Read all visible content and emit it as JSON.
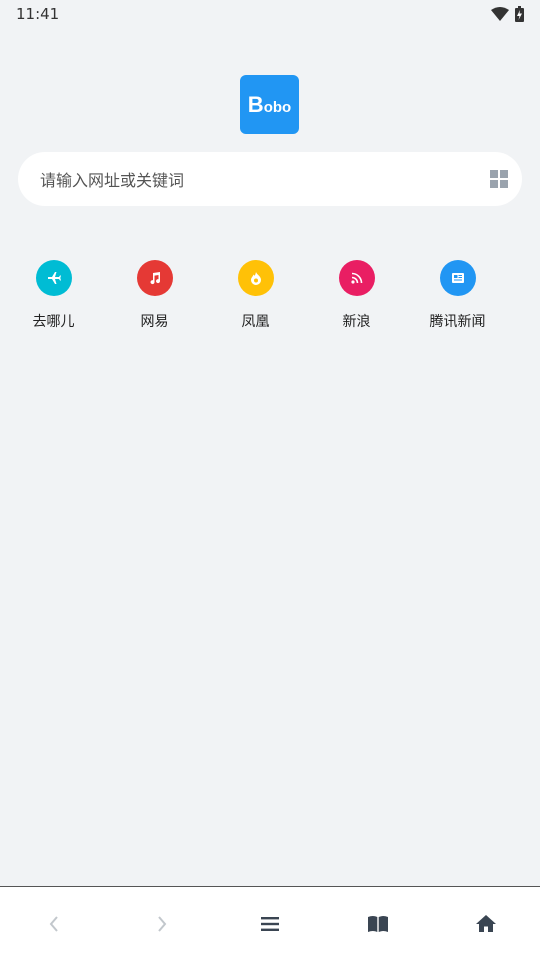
{
  "status_bar": {
    "time": "11:41"
  },
  "logo": {
    "text_big": "B",
    "text_small": "obo",
    "color": "#2196f3"
  },
  "search": {
    "placeholder": "请输入网址或关键词"
  },
  "shortcuts": [
    {
      "label": "去哪儿",
      "icon": "airplane-icon",
      "color": "#00bcd4"
    },
    {
      "label": "网易",
      "icon": "music-note-icon",
      "color": "#e53935"
    },
    {
      "label": "凤凰",
      "icon": "fire-icon",
      "color": "#ffc107"
    },
    {
      "label": "新浪",
      "icon": "rss-icon",
      "color": "#e91e63"
    },
    {
      "label": "腾讯新闻",
      "icon": "newspaper-icon",
      "color": "#2196f3"
    }
  ],
  "bottom_nav": [
    {
      "icon": "back-arrow-icon"
    },
    {
      "icon": "forward-arrow-icon"
    },
    {
      "icon": "menu-icon"
    },
    {
      "icon": "bookmarks-icon"
    },
    {
      "icon": "home-icon"
    }
  ]
}
